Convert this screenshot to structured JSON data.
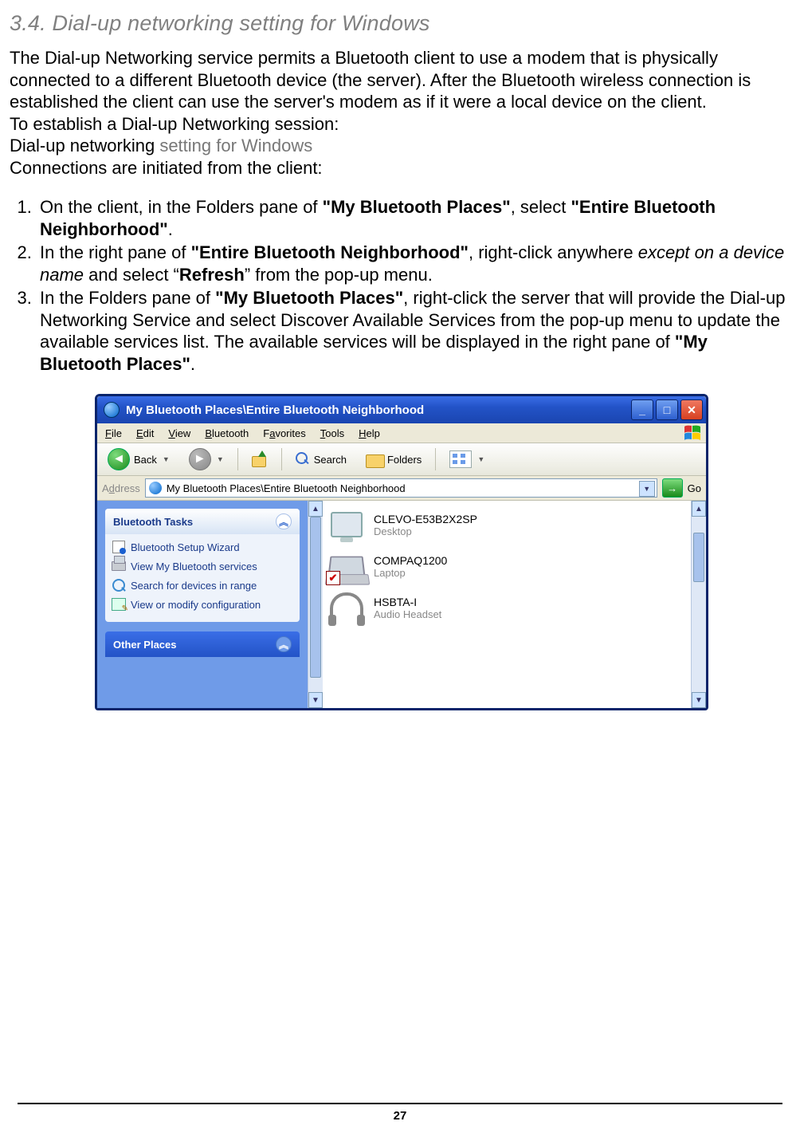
{
  "section_title": "3.4. Dial-up networking setting for Windows",
  "intro": {
    "p1": "The Dial-up Networking service permits a Bluetooth client to use a modem that is physically connected to a different Bluetooth device (the server). After the Bluetooth wireless connection is established the client can use the server's modem as if it were a local device on the client.",
    "p2": "To establish a Dial-up Networking session:",
    "p3a": "Dial-up networking ",
    "p3b": "setting for Windows",
    "p4": "Connections are initiated from the client:"
  },
  "steps": {
    "s1": {
      "t1": "On the client, in the Folders pane of ",
      "b1": "\"My Bluetooth Places\"",
      "t2": ", select ",
      "b2": "\"Entire Bluetooth Neighborhood\"",
      "t3": "."
    },
    "s2": {
      "t1": "In the right pane of ",
      "b1": "\"Entire Bluetooth Neighborhood\"",
      "t2": ", right-click anywhere ",
      "i1": "except on a device name",
      "t3": " and select “",
      "b2": "Refresh",
      "t4": "” from the pop-up menu."
    },
    "s3": {
      "t1": "In the Folders pane of ",
      "b1": "\"My Bluetooth Places\"",
      "t2": ", right-click the server that will provide the Dial-up Networking Service and select Discover Available Services from the pop-up menu to update the available services list. The available services will be displayed in the right pane of ",
      "b2": "\"My Bluetooth Places\"",
      "t3": "."
    }
  },
  "win": {
    "title": "My Bluetooth Places\\Entire Bluetooth Neighborhood",
    "menus": {
      "file": "File",
      "edit": "Edit",
      "view": "View",
      "bluetooth": "Bluetooth",
      "favorites": "Favorites",
      "tools": "Tools",
      "help": "Help"
    },
    "toolbar": {
      "back": "Back",
      "search": "Search",
      "folders": "Folders"
    },
    "address": {
      "label": "Address",
      "value": "My Bluetooth Places\\Entire Bluetooth Neighborhood",
      "go": "Go"
    },
    "tasks": {
      "header": "Bluetooth Tasks",
      "items": [
        "Bluetooth Setup Wizard",
        "View My Bluetooth services",
        "Search for devices in range",
        "View or modify configuration"
      ],
      "other": "Other Places"
    },
    "devices": [
      {
        "name": "CLEVO-E53B2X2SP",
        "type": "Desktop"
      },
      {
        "name": "COMPAQ1200",
        "type": "Laptop"
      },
      {
        "name": "HSBTA-I",
        "type": "Audio Headset"
      }
    ]
  },
  "page_number": "27"
}
